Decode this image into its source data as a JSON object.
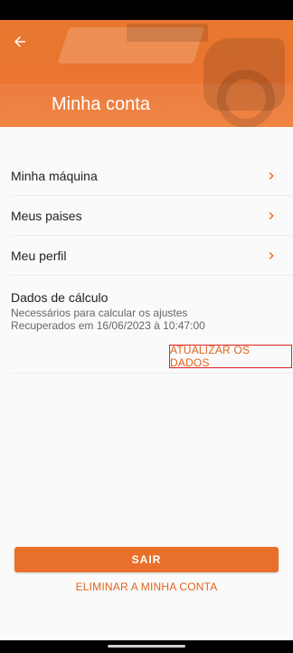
{
  "header": {
    "title": "Minha conta",
    "back_icon": "arrow-left-icon",
    "accent_color": "#ea7430"
  },
  "menu": {
    "items": [
      {
        "label": "Minha máquina",
        "icon": "chevron-right-icon"
      },
      {
        "label": "Meus paises",
        "icon": "chevron-right-icon"
      },
      {
        "label": "Meu perfil",
        "icon": "chevron-right-icon"
      }
    ]
  },
  "calc": {
    "title": "Dados de cálculo",
    "subtitle": "Necessários para calcular os ajustes",
    "retrieved": "Recuperados em 16/06/2023 à 10:47:00",
    "update_label": "ATUALIZAR OS DADOS"
  },
  "actions": {
    "logout_label": "SAIR",
    "delete_label": "ELIMINAR A MINHA CONTA"
  }
}
